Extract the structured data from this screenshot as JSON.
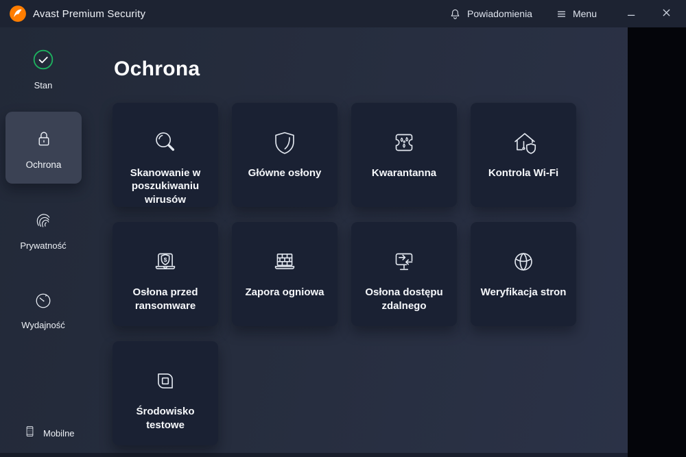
{
  "window": {
    "title": "Avast Premium Security"
  },
  "titlebar": {
    "notifications_label": "Powiadomienia",
    "menu_label": "Menu"
  },
  "sidebar": {
    "items": [
      {
        "label": "Stan",
        "icon": "status-check-icon",
        "selected": false
      },
      {
        "label": "Ochrona",
        "icon": "lock-icon",
        "selected": true
      },
      {
        "label": "Prywatność",
        "icon": "fingerprint-icon",
        "selected": false
      },
      {
        "label": "Wydajność",
        "icon": "gauge-icon",
        "selected": false
      }
    ],
    "bottom_item": {
      "label": "Mobilne",
      "icon": "phone-icon"
    }
  },
  "main": {
    "title": "Ochrona",
    "cards": [
      {
        "label": "Skanowanie w poszukiwaniu wirusów",
        "icon": "search-icon"
      },
      {
        "label": "Główne osłony",
        "icon": "shield-icon"
      },
      {
        "label": "Kwarantanna",
        "icon": "quarantine-icon"
      },
      {
        "label": "Kontrola Wi-Fi",
        "icon": "wifi-home-icon"
      },
      {
        "label": "Osłona przed ransomware",
        "icon": "ransomware-shield-icon"
      },
      {
        "label": "Zapora ogniowa",
        "icon": "firewall-icon"
      },
      {
        "label": "Osłona dostępu zdalnego",
        "icon": "remote-access-icon"
      },
      {
        "label": "Weryfikacja stron",
        "icon": "globe-icon"
      },
      {
        "label": "Środowisko testowe",
        "icon": "sandbox-icon"
      }
    ]
  },
  "colors": {
    "titlebar_bg": "#1d2332",
    "body_bg": "#262d3e",
    "card_bg": "#1a2133",
    "selected_tile_bg": "#3b4254",
    "accent_orange": "#ff7d00",
    "status_green": "#1db25f",
    "icon_stroke": "#e3e8f0",
    "text": "#f6f8fb"
  }
}
